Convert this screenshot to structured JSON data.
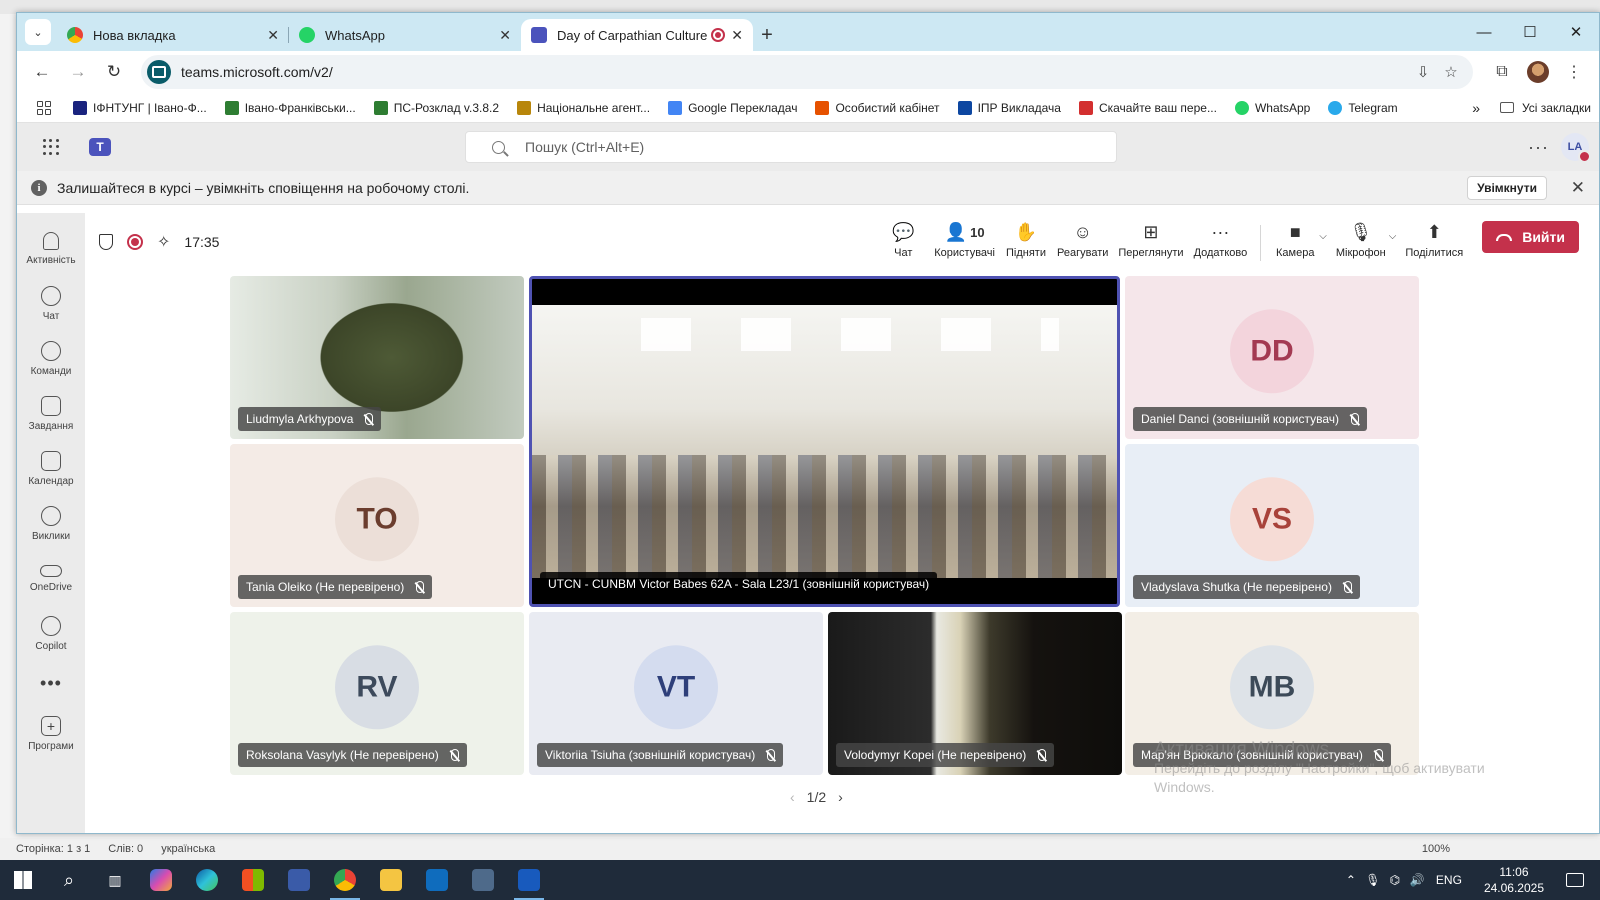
{
  "browser": {
    "tabs": [
      {
        "label": "Нова вкладка",
        "icon": "chrome-icon",
        "color": "#4285f4"
      },
      {
        "label": "WhatsApp",
        "icon": "whatsapp-icon",
        "color": "#25d366"
      },
      {
        "label": "Day of Carpathian Culture С",
        "icon": "teams-icon",
        "color": "#4b53bc",
        "active": true
      }
    ],
    "url": "teams.microsoft.com/v2/",
    "bookmarks": [
      {
        "label": "ІФНТУНГ | Івано-Ф...",
        "color": "#1a237e"
      },
      {
        "label": "Івано-Франківськи...",
        "color": "#2e7d32"
      },
      {
        "label": "ПС-Розклад v.3.8.2",
        "color": "#2e7d32"
      },
      {
        "label": "Національне агент...",
        "color": "#b8860b"
      },
      {
        "label": "Google Перекладач",
        "color": "#4285f4"
      },
      {
        "label": "Особистий кабінет",
        "color": "#e65100"
      },
      {
        "label": "ІПР Викладача",
        "color": "#0d47a1"
      },
      {
        "label": "Скачайте ваш пере...",
        "color": "#d32f2f"
      },
      {
        "label": "WhatsApp",
        "color": "#25d366"
      },
      {
        "label": "Telegram",
        "color": "#29a9eb"
      }
    ],
    "bookmarks_more": "»",
    "all_bookmarks": "Усі закладки"
  },
  "teams": {
    "search_placeholder": "Пошук (Ctrl+Alt+E)",
    "me_initials": "LA",
    "notify_text": "Залишайтеся в курсі – увімкніть сповіщення на робочому столі.",
    "notify_button": "Увімкнути",
    "rail": [
      {
        "label": "Активність",
        "icon": "bell-icon"
      },
      {
        "label": "Чат",
        "icon": "chat-icon"
      },
      {
        "label": "Команди",
        "icon": "teams-people-icon"
      },
      {
        "label": "Завдання",
        "icon": "tasks-icon"
      },
      {
        "label": "Календар",
        "icon": "calendar-icon"
      },
      {
        "label": "Виклики",
        "icon": "phone-icon"
      },
      {
        "label": "OneDrive",
        "icon": "cloud-icon"
      },
      {
        "label": "Copilot",
        "icon": "copilot-icon"
      }
    ],
    "rail_more": "•••",
    "rail_apps": "Програми",
    "meeting": {
      "timer": "17:35",
      "buttons": [
        {
          "label": "Чат",
          "icon": "chat-icon",
          "glyph": "💬"
        },
        {
          "label": "Користувачі",
          "icon": "people-icon",
          "glyph": "👤",
          "count": "10"
        },
        {
          "label": "Підняти",
          "icon": "raise-hand-icon",
          "glyph": "✋"
        },
        {
          "label": "Реагувати",
          "icon": "emoji-icon",
          "glyph": "☺"
        },
        {
          "label": "Переглянути",
          "icon": "view-grid-icon",
          "glyph": "⊞"
        },
        {
          "label": "Додатково",
          "icon": "more-icon",
          "glyph": "···"
        }
      ],
      "camera_label": "Камера",
      "mic_label": "Мікрофон",
      "share_label": "Поділитися",
      "leave_label": "Вийти"
    },
    "participants": [
      {
        "name": "Liudmyla Arkhypova",
        "type": "video"
      },
      {
        "name": "UTCN - CUNBM Victor Babes 62A - Sala L23/1 (зовнішній користувач)",
        "type": "room"
      },
      {
        "name": "Daniel Danci (зовнішній користувач)",
        "initials": "DD",
        "bg": "#f5e6ea",
        "avatar_bg": "#f3d4dc",
        "avatar_fg": "#a33a52"
      },
      {
        "name": "Tania Oleiko (Не перевірено)",
        "initials": "TO",
        "bg": "#f4ebe6",
        "avatar_bg": "#ecdfd8",
        "avatar_fg": "#6b3d2e"
      },
      {
        "name": "Vladyslava Shutka (Не перевірено)",
        "initials": "VS",
        "bg": "#e8eef6",
        "avatar_bg": "#f6dcd6",
        "avatar_fg": "#a8423a"
      },
      {
        "name": "Roksolana Vasylyk (Не перевірено)",
        "initials": "RV",
        "bg": "#eef2ea",
        "avatar_bg": "#d8dde4",
        "avatar_fg": "#3d4a5c"
      },
      {
        "name": "Viktoriia Tsiuha (зовнішній користувач)",
        "initials": "VT",
        "bg": "#e9ebf2",
        "avatar_bg": "#d4dcef",
        "avatar_fg": "#2e3f7a"
      },
      {
        "name": "Volodymyr Kopei (Не перевірено)",
        "type": "video-dark"
      },
      {
        "name": "Мар'ян Врюкало (зовнішній користувач)",
        "initials": "MB",
        "bg": "#f3eee6",
        "avatar_bg": "#dee3e8",
        "avatar_fg": "#3c4a58"
      }
    ],
    "pager": "1/2"
  },
  "watermark": {
    "title": "Активация Windows",
    "line1": "Перейдіть до розділу \"Настройки\", щоб активувати",
    "line2": "Windows."
  },
  "word_status": {
    "page": "Сторінка: 1 з 1",
    "words": "Слів: 0",
    "lang": "українська",
    "zoom": "100%"
  },
  "taskbar": {
    "lang": "ENG",
    "time": "11:06",
    "date": "24.06.2025"
  },
  "colors": {
    "teams_brand": "#4b53bc",
    "leave_red": "#c4314b",
    "active_tile": "#4f52b2"
  }
}
